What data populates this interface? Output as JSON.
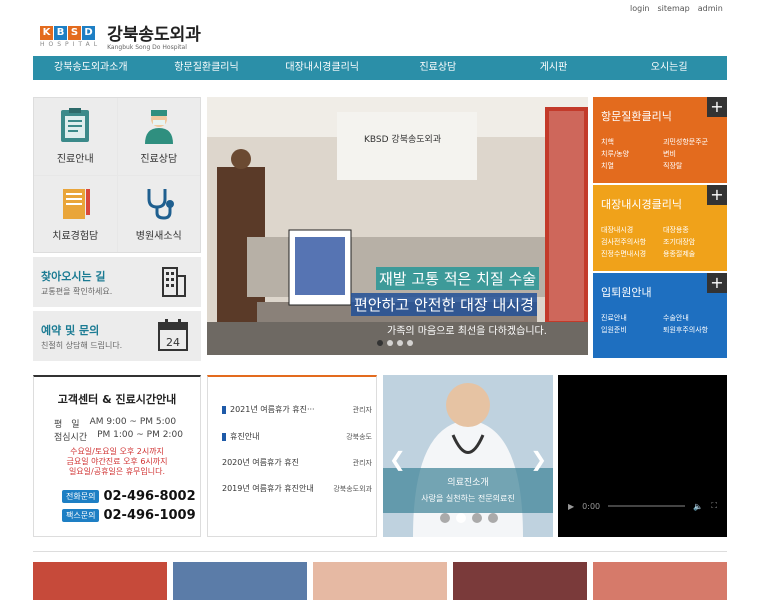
{
  "top_links": [
    "login",
    "sitemap",
    "admin"
  ],
  "logo": {
    "letters": [
      "K",
      "B",
      "S",
      "D"
    ],
    "sub": "HOSPITAL",
    "name": "강북송도외과",
    "name_en": "Kangbuk Song Do Hospital"
  },
  "nav": [
    "강북송도외과소개",
    "항문질환클리닉",
    "대장내시경클리닉",
    "진료상담",
    "게시판",
    "오시는길"
  ],
  "tiles": [
    {
      "label": "진료안내",
      "icon": "clipboard-icon"
    },
    {
      "label": "진료상담",
      "icon": "doctor-icon"
    },
    {
      "label": "치료경험담",
      "icon": "notebook-pencil-icon"
    },
    {
      "label": "병원새소식",
      "icon": "stethoscope-icon"
    }
  ],
  "directions": {
    "title": "찾아오시는 길",
    "desc": "교통편을 확인하세요."
  },
  "reservation": {
    "title": "예약 및 문의",
    "desc": "친절히 상담해 드립니다."
  },
  "slider": {
    "sign": "KBSD 강북송도외과",
    "line1": "재발 고통 적은 치질 수술",
    "line2": "편안하고 안전한 대장 내시경",
    "line3": "가족의 마음으로 최선을 다하겠습니다."
  },
  "panels": [
    {
      "title": "항문질환클리닉",
      "color": "#e36b1e",
      "items": [
        "치핵",
        "괴민성항문주군",
        "치루/농양",
        "변비",
        "치열",
        "직장탈"
      ]
    },
    {
      "title": "대장내시경클리닉",
      "color": "#f0a21a",
      "items": [
        "대장내시경",
        "대장용종",
        "검사전주의사항",
        "조기대장암",
        "진정수면내시경",
        "용종절제술"
      ]
    },
    {
      "title": "입퇴원안내",
      "color": "#1e6fc0",
      "items": [
        "진료안내",
        "수술안내",
        "입원준비",
        "퇴원후주의사항"
      ]
    }
  ],
  "info": {
    "title": "고객센터 & 진료시간안내",
    "rows": [
      {
        "day": "평　일",
        "time": "AM 9:00 ~ PM 5:00"
      },
      {
        "day": "점심시간",
        "time": "PM 1:00 ~ PM 2:00"
      }
    ],
    "notes": [
      "수요일/토요일 오후 2시까지",
      "금요일 야간진료 오후 6시까지",
      "일요일/공휴일은 휴무입니다."
    ],
    "phones": [
      {
        "label": "전화문의",
        "number": "02-496-8002"
      },
      {
        "label": "팩스문의",
        "number": "02-496-1009"
      }
    ]
  },
  "board": [
    {
      "title": "2021년 여름휴가 휴진···",
      "author": "관리자",
      "marker": true
    },
    {
      "title": "휴진안내",
      "author": "강북송도",
      "marker": true
    },
    {
      "title": "2020년 여름휴가 휴진",
      "author": "관리자",
      "marker": false
    },
    {
      "title": "2019년 여름휴가 휴진안내",
      "author": "강북송도외과",
      "marker": false
    }
  ],
  "doctor": {
    "title": "의료진소개",
    "desc": "사랑을 실천하는 전문의료진"
  },
  "video": {
    "time": "0:00"
  }
}
